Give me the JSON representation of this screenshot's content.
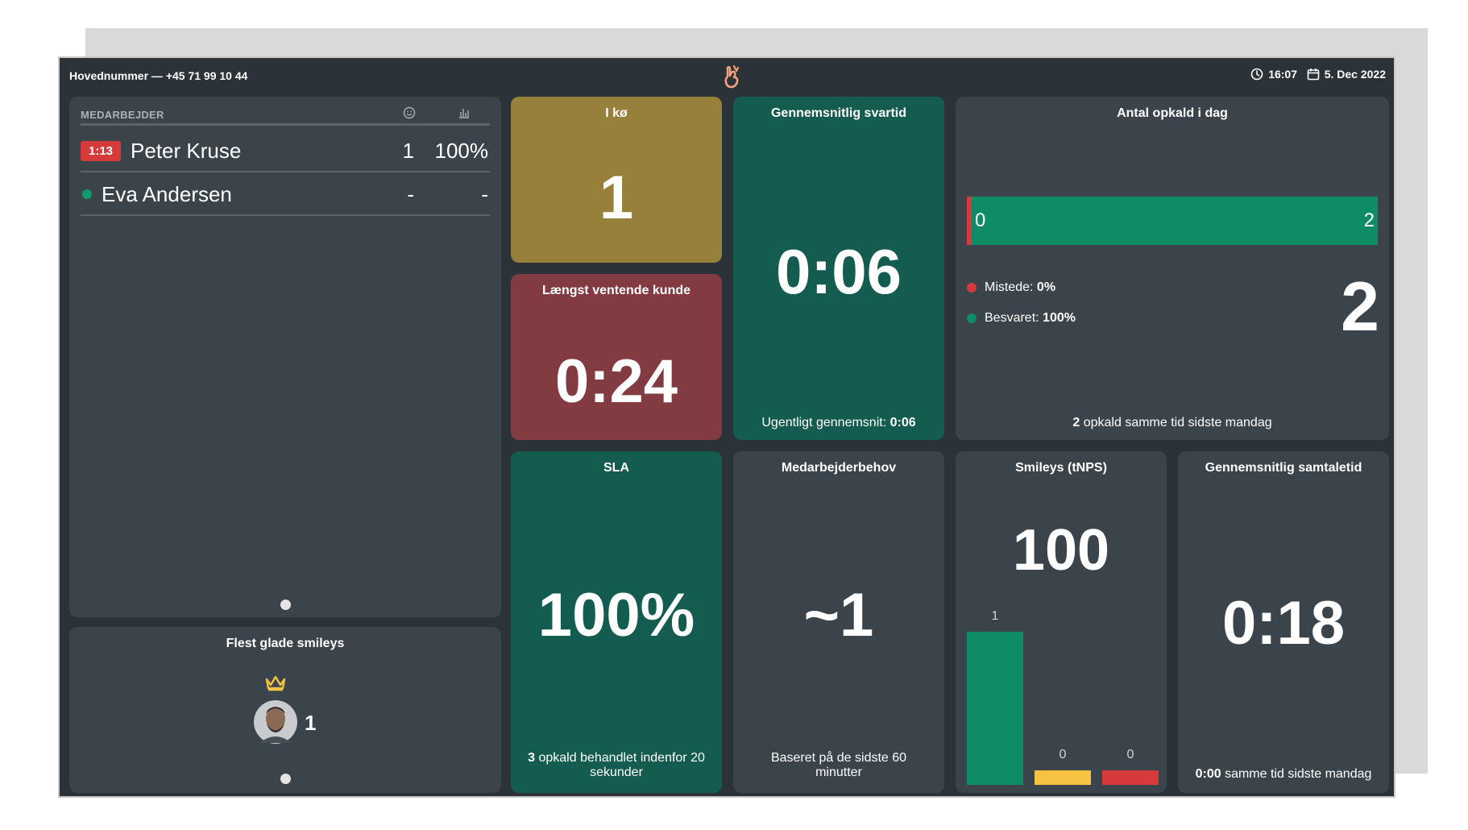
{
  "header": {
    "main_number_label": "Hovednummer",
    "main_number_sep": "—",
    "main_number": "+45 71 99 10 44",
    "time": "16:07",
    "date": "5. Dec 2022"
  },
  "staff": {
    "column_header": "MEDARBEJDER",
    "rows": [
      {
        "badge": "1:13",
        "name": "Peter Kruse",
        "calls": "1",
        "pct": "100%"
      },
      {
        "name": "Eva Andersen",
        "calls": "-",
        "pct": "-"
      }
    ]
  },
  "happy": {
    "title": "Flest glade smileys",
    "count": "1"
  },
  "queue": {
    "title": "I kø",
    "value": "1"
  },
  "longest": {
    "title": "Længst ventende kunde",
    "value": "0:24"
  },
  "avg_response": {
    "title": "Gennemsnitlig svartid",
    "value": "0:06",
    "weekly_label": "Ugentligt gennemsnit:",
    "weekly_value": "0:06"
  },
  "calls_today": {
    "title": "Antal opkald i dag",
    "bar_min": "0",
    "bar_max": "2",
    "missed_label": "Mistede:",
    "missed_value": "0%",
    "answered_label": "Besvaret:",
    "answered_value": "100%",
    "total": "2",
    "compare_value": "2",
    "compare_text": "opkald samme tid sidste mandag"
  },
  "sla": {
    "title": "SLA",
    "value": "100%",
    "foot_count": "3",
    "foot_text": "opkald behandlet indenfor 20 sekunder"
  },
  "staff_need": {
    "title": "Medarbejderbehov",
    "value": "~1",
    "foot_text": "Baseret på de sidste 60 minutter"
  },
  "smileys": {
    "title": "Smileys (tNPS)",
    "value": "100",
    "chart_data": {
      "type": "bar",
      "categories": [
        "positive",
        "neutral",
        "negative"
      ],
      "values": [
        1,
        0,
        0
      ],
      "colors": [
        "#0e8c66",
        "#f5c242",
        "#d63a3a"
      ]
    },
    "labels": [
      "1",
      "0",
      "0"
    ]
  },
  "avg_talk": {
    "title": "Gennemsnitlig samtaletid",
    "value": "0:18",
    "foot_value": "0:00",
    "foot_text": "samme tid sidste mandag"
  },
  "colors": {
    "bg": "#2b3238",
    "panel": "#3b444b",
    "gold": "#97803c",
    "wine": "#833b42",
    "teal": "#145c4f",
    "green": "#0e8c66",
    "red": "#d63a3a",
    "yellow": "#f5c242",
    "accent_logo": "#f2a07b"
  }
}
